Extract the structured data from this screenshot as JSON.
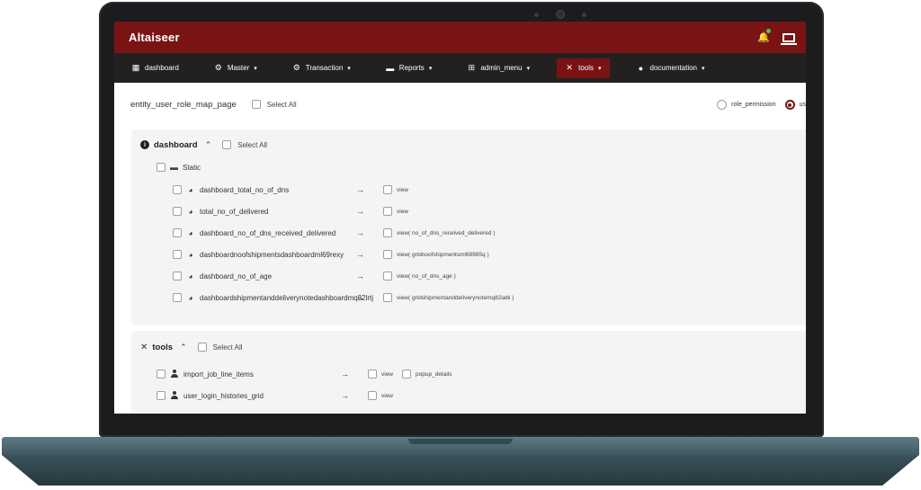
{
  "app": {
    "brand": "Altaiseer"
  },
  "nav": [
    {
      "label": "dashboard",
      "icon": "grid-icon"
    },
    {
      "label": "Master",
      "icon": "gear-icon"
    },
    {
      "label": "Transaction",
      "icon": "gear-icon"
    },
    {
      "label": "Reports",
      "icon": "folder-icon"
    },
    {
      "label": "admin_menu",
      "icon": "sitemap-icon"
    },
    {
      "label": "tools",
      "icon": "tools-icon",
      "active": true
    },
    {
      "label": "documentation",
      "icon": "info-icon"
    }
  ],
  "page": {
    "title": "entity_user_role_map_page",
    "select_all": "Select All",
    "radios": [
      {
        "label": "role_permission",
        "selected": false
      },
      {
        "label": "user_p",
        "selected": true
      }
    ]
  },
  "sections": [
    {
      "title": "dashboard",
      "select_all": "Select All",
      "group": "Static",
      "items": [
        {
          "name": "dashboard_total_no_of_dns",
          "arrow": "→",
          "perms": [
            "view"
          ]
        },
        {
          "name": "total_no_of_delivered",
          "arrow": "→",
          "perms": [
            "view"
          ]
        },
        {
          "name": "dashboard_no_of_dns_received_delivered",
          "arrow": "→",
          "perms": [
            "view( no_of_dns_received_delivered )"
          ]
        },
        {
          "name": "dashboardnoofshipmentsdashboardml69rexy",
          "arrow": "→",
          "perms": [
            "view( gridnoofshipmentsml69985q )"
          ]
        },
        {
          "name": "dashboard_no_of_age",
          "arrow": "→",
          "perms": [
            "view( no_of_dns_age )"
          ]
        },
        {
          "name": "dashboardshipmentanddeliverynotedashboardmq82lrtj",
          "arrow": "→",
          "perms": [
            "view( gridshipmentanddeliverynotemq82iabi )"
          ]
        }
      ]
    },
    {
      "title": "tools",
      "select_all": "Select All",
      "items": [
        {
          "name": "import_job_line_items",
          "arrow": "→",
          "perms": [
            "view",
            "popup_details"
          ]
        },
        {
          "name": "user_login_histories_grid",
          "arrow": "→",
          "perms": [
            "view"
          ]
        }
      ]
    }
  ],
  "colors": {
    "primary": "#7a1414",
    "nav_bg": "#23211f",
    "section_bg": "#f4f4f4",
    "status_dot": "#3ecf4a"
  }
}
